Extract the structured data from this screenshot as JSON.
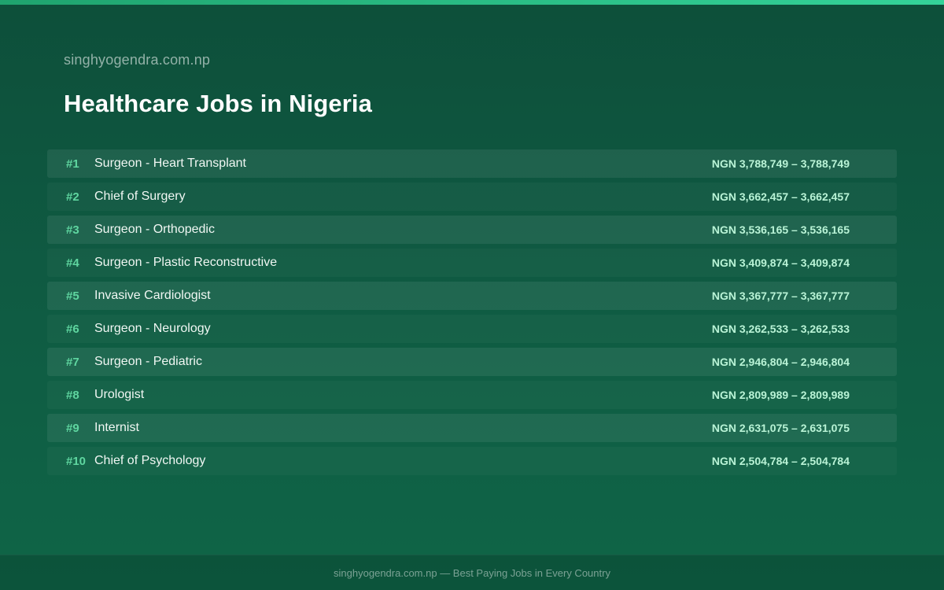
{
  "site": {
    "name": "singhyogendra.com.np"
  },
  "page": {
    "title": "Healthcare Jobs in Nigeria"
  },
  "colors": {
    "accent": "#5fd6a0",
    "salary": "#b9f3d6",
    "top_bar": "#34d399",
    "background": "#0f5a42"
  },
  "jobs": [
    {
      "rank": "#1",
      "title": "Surgeon - Heart Transplant",
      "salary": "NGN 3,788,749 – 3,788,749"
    },
    {
      "rank": "#2",
      "title": "Chief of Surgery",
      "salary": "NGN 3,662,457 – 3,662,457"
    },
    {
      "rank": "#3",
      "title": "Surgeon - Orthopedic",
      "salary": "NGN 3,536,165 – 3,536,165"
    },
    {
      "rank": "#4",
      "title": "Surgeon - Plastic Reconstructive",
      "salary": "NGN 3,409,874 – 3,409,874"
    },
    {
      "rank": "#5",
      "title": "Invasive Cardiologist",
      "salary": "NGN 3,367,777 – 3,367,777"
    },
    {
      "rank": "#6",
      "title": "Surgeon - Neurology",
      "salary": "NGN 3,262,533 – 3,262,533"
    },
    {
      "rank": "#7",
      "title": "Surgeon - Pediatric",
      "salary": "NGN 2,946,804 – 2,946,804"
    },
    {
      "rank": "#8",
      "title": "Urologist",
      "salary": "NGN 2,809,989 – 2,809,989"
    },
    {
      "rank": "#9",
      "title": "Internist",
      "salary": "NGN 2,631,075 – 2,631,075"
    },
    {
      "rank": "#10",
      "title": "Chief of Psychology",
      "salary": "NGN 2,504,784 – 2,504,784"
    }
  ],
  "footer": {
    "text": "singhyogendra.com.np — Best Paying Jobs in Every Country"
  }
}
